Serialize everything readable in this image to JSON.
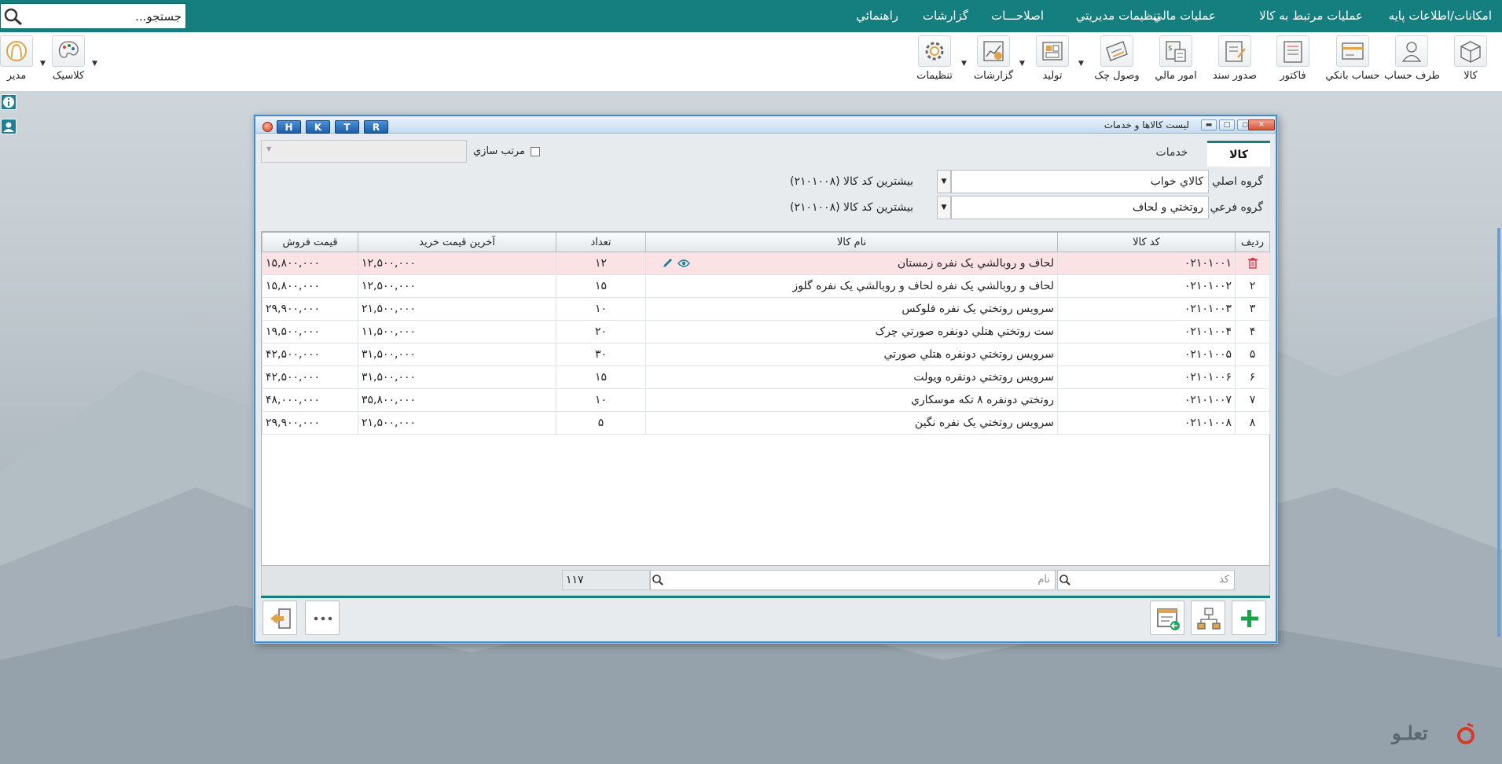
{
  "menu": {
    "items": [
      "امکانات/اطلاعات پايه",
      "عمليات مرتبط به کالا",
      "عمليات مالي",
      "تنظيمات مديريتي",
      "اصلاحـــات",
      "گزارشات",
      "راهنمائي"
    ],
    "search_placeholder": "جستجو..."
  },
  "toolbar": {
    "buttons": [
      "کالا",
      "طرف حساب",
      "حساب بانکي",
      "فاکتور",
      "صدور سند",
      "امور مالي",
      "وصول چک",
      "توليد",
      "گزارشات",
      "تنظيمات"
    ],
    "theme_label": "کلاسيک",
    "user_label": "مدير"
  },
  "window": {
    "title": "ليست کالاها و خدمات",
    "hotkeys": [
      "H",
      "K",
      "T",
      "R"
    ],
    "tabs": [
      "کالا",
      "خدمات"
    ],
    "sort_label": "مرتب سازي",
    "main_group_label": "گروه اصلي",
    "main_group_value": "کالاي خواب",
    "main_group_note": "بيشترين کد کالا (۲۱۰۱۰۰۸)",
    "sub_group_label": "گروه فرعي",
    "sub_group_value": "روتختي و لحاف",
    "sub_group_note": "بيشترين کد کالا (۲۱۰۱۰۰۸)"
  },
  "table": {
    "headers": [
      "رديف",
      "کد کالا",
      "نام کالا",
      "تعداد",
      "آخرين قيمت خريد",
      "قيمت فروش"
    ],
    "rows": [
      {
        "idx": "",
        "code": "۰۲۱۰۱۰۰۱",
        "name": "لحاف و روبالشي يک نفره زمستان",
        "qty": "۱۲",
        "buy": "۱۲,۵۰۰,۰۰۰",
        "sell": "۱۵,۸۰۰,۰۰۰"
      },
      {
        "idx": "۲",
        "code": "۰۲۱۰۱۰۰۲",
        "name": "لحاف و روبالشي يک نفره لحاف و روبالشي يک نفره گلوز",
        "qty": "۱۵",
        "buy": "۱۲,۵۰۰,۰۰۰",
        "sell": "۱۵,۸۰۰,۰۰۰"
      },
      {
        "idx": "۳",
        "code": "۰۲۱۰۱۰۰۳",
        "name": "سرويس روتختي يک نفره فلوکس",
        "qty": "۱۰",
        "buy": "۲۱,۵۰۰,۰۰۰",
        "sell": "۲۹,۹۰۰,۰۰۰"
      },
      {
        "idx": "۴",
        "code": "۰۲۱۰۱۰۰۴",
        "name": "ست روتختي هتلي دونفره صورتي چرک",
        "qty": "۲۰",
        "buy": "۱۱,۵۰۰,۰۰۰",
        "sell": "۱۹,۵۰۰,۰۰۰"
      },
      {
        "idx": "۵",
        "code": "۰۲۱۰۱۰۰۵",
        "name": "سرويس روتختي دونفره هتلي صورتي",
        "qty": "۳۰",
        "buy": "۳۱,۵۰۰,۰۰۰",
        "sell": "۴۲,۵۰۰,۰۰۰"
      },
      {
        "idx": "۶",
        "code": "۰۲۱۰۱۰۰۶",
        "name": "سرويس روتختي دونفره ويولت",
        "qty": "۱۵",
        "buy": "۳۱,۵۰۰,۰۰۰",
        "sell": "۴۲,۵۰۰,۰۰۰"
      },
      {
        "idx": "۷",
        "code": "۰۲۱۰۱۰۰۷",
        "name": "روتختي دونفره ۸ تکه موسکاري",
        "qty": "۱۰",
        "buy": "۳۵,۸۰۰,۰۰۰",
        "sell": "۴۸,۰۰۰,۰۰۰"
      },
      {
        "idx": "۸",
        "code": "۰۲۱۰۱۰۰۸",
        "name": "سرويس روتختي يک نفره نگين",
        "qty": "۵",
        "buy": "۲۱,۵۰۰,۰۰۰",
        "sell": "۲۹,۹۰۰,۰۰۰"
      }
    ]
  },
  "footer": {
    "code_placeholder": "کد",
    "name_placeholder": "نام",
    "total_qty": "۱۱۷"
  },
  "logo_text": "تعلـو",
  "colors": {
    "menu_bg": "#157f80",
    "accent": "#157f80",
    "selected_row": "#fbe3e5",
    "add": "#1aa34a"
  }
}
